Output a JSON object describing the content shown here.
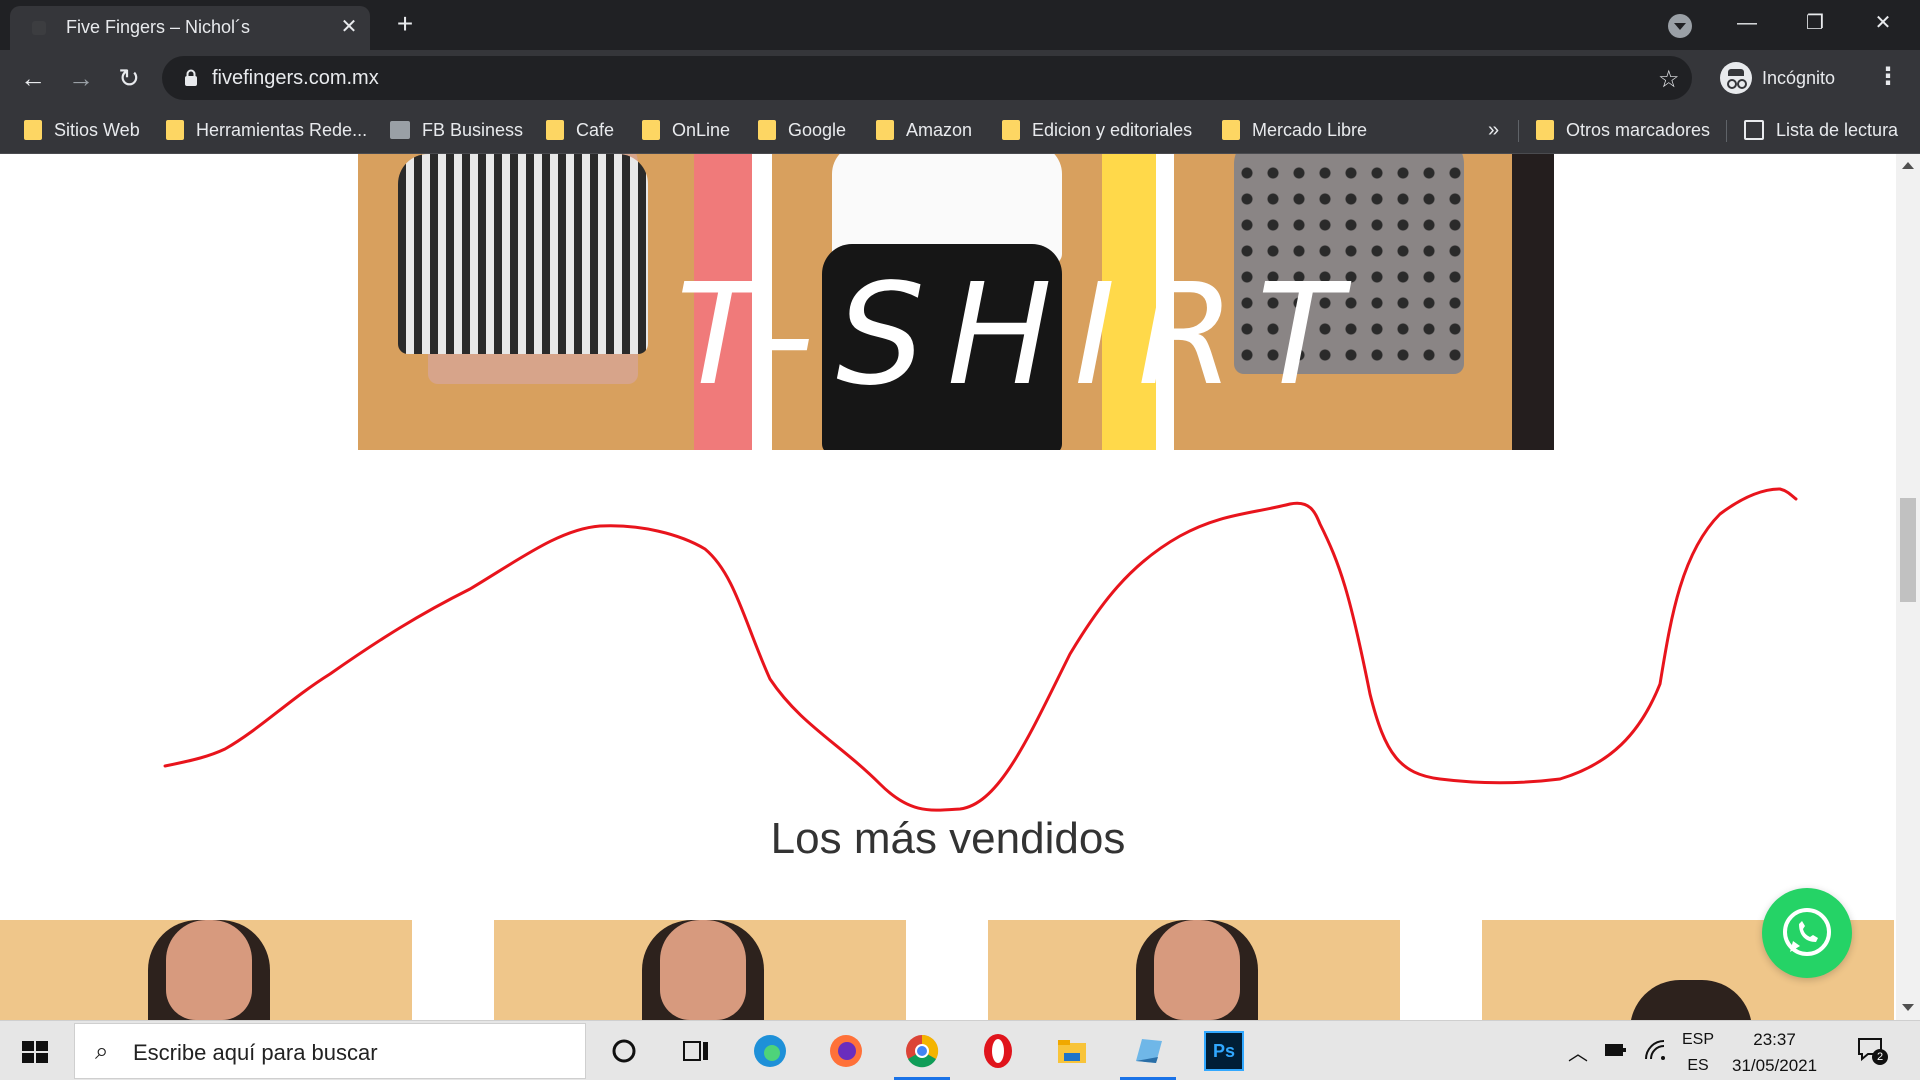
{
  "browser": {
    "tab_title": "Five Fingers – Nichol´s",
    "tab_close": "✕",
    "new_tab": "+",
    "url": "fivefingers.com.mx",
    "profile_label": "Incógnito",
    "window_controls": {
      "minimize": "—",
      "restore": "❐",
      "close": "✕"
    }
  },
  "bookmarks": {
    "items": [
      {
        "label": "Sitios Web",
        "icon": "folder-icon"
      },
      {
        "label": "Herramientas Rede...",
        "icon": "folder-icon"
      },
      {
        "label": "FB Business",
        "icon": "page-icon"
      },
      {
        "label": "Cafe",
        "icon": "folder-icon"
      },
      {
        "label": "OnLine",
        "icon": "folder-icon"
      },
      {
        "label": "Google",
        "icon": "folder-icon"
      },
      {
        "label": "Amazon",
        "icon": "folder-icon"
      },
      {
        "label": "Edicion y editoriales",
        "icon": "folder-icon"
      },
      {
        "label": "Mercado Libre",
        "icon": "folder-icon"
      }
    ],
    "overflow": "»",
    "other_bookmarks": "Otros marcadores",
    "reading_list": "Lista de lectura"
  },
  "page": {
    "banner_text": "T-SHIRT",
    "section_title": "Los más vendidos",
    "colors": {
      "banner_bg": "#d8a05e",
      "pink": "#f07a7a",
      "yellow": "#ffd94a",
      "scribble": "#e8141c",
      "whatsapp": "#25d366"
    }
  },
  "taskbar": {
    "search_placeholder": "Escribe aquí para buscar",
    "apps": [
      "cortana-icon",
      "task-view-icon",
      "edge-icon",
      "firefox-icon",
      "chrome-icon",
      "opera-icon",
      "file-explorer-icon",
      "notes-icon",
      "photoshop-icon"
    ],
    "photoshop_label": "Ps",
    "lang_top": "ESP",
    "lang_bottom": "ES",
    "time": "23:37",
    "date": "31/05/2021",
    "notifications": "2"
  }
}
